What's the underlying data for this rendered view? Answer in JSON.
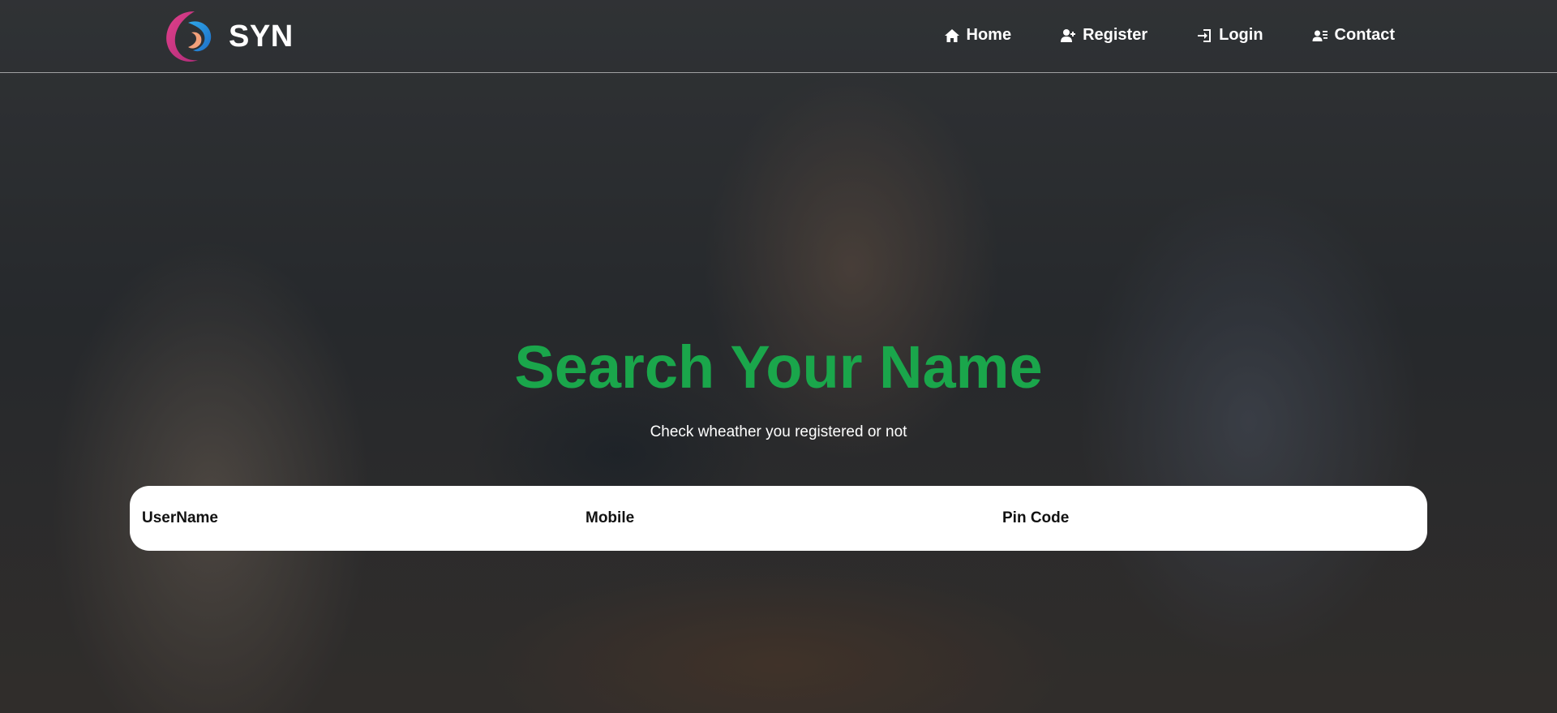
{
  "brand": {
    "name": "SYN"
  },
  "nav": {
    "items": [
      {
        "label": "Home",
        "icon": "home-icon"
      },
      {
        "label": "Register",
        "icon": "user-plus-icon"
      },
      {
        "label": "Login",
        "icon": "login-icon"
      },
      {
        "label": "Contact",
        "icon": "contact-icon"
      }
    ]
  },
  "hero": {
    "title": "Search Your Name",
    "subtitle": "Check wheather you registered or not"
  },
  "search": {
    "username_placeholder": "UserName",
    "mobile_placeholder": "Mobile",
    "pincode_placeholder": "Pin Code"
  },
  "colors": {
    "title": "#1aa64b",
    "nav_text": "#ffffff",
    "search_bg": "#ffffff"
  }
}
